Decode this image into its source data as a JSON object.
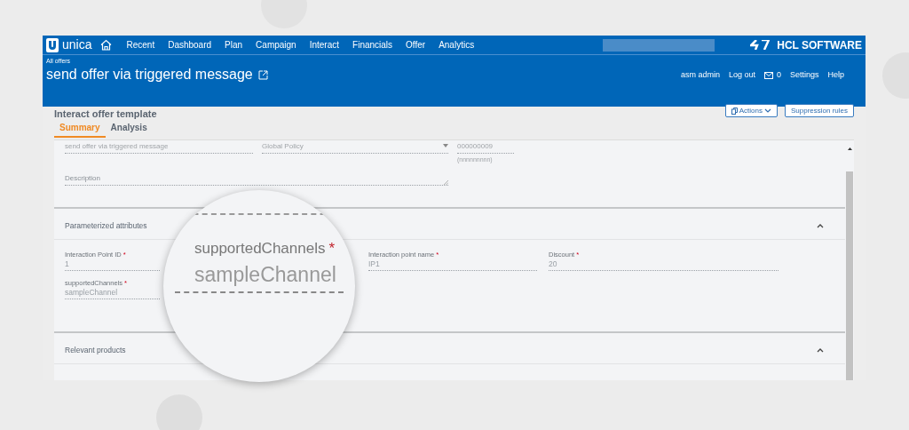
{
  "nav": {
    "logo": "unica",
    "items": [
      "Recent",
      "Dashboard",
      "Plan",
      "Campaign",
      "Interact",
      "Financials",
      "Offer",
      "Analytics"
    ],
    "brand": "HCL SOFTWARE"
  },
  "header": {
    "breadcrumb": "All offers",
    "title": "send offer via triggered message",
    "user": "asm admin",
    "logout": "Log out",
    "messages": "0",
    "links": [
      "Settings",
      "Help"
    ]
  },
  "page": {
    "subtitle": "Interact offer template",
    "actions": [
      "Actions",
      "Suppression rules"
    ],
    "tabs": [
      {
        "label": "Summary",
        "selected": true
      },
      {
        "label": "Analysis",
        "selected": false
      }
    ]
  },
  "form": {
    "name": "send offer via triggered message",
    "policy": "Global Policy",
    "code": "000000009",
    "code_hint": "(nnnnnnnnn)",
    "description_placeholder": "Description"
  },
  "sections": [
    {
      "title": "Parameterized attributes",
      "expanded": true,
      "fields": [
        {
          "label": "Interaction Point ID",
          "required_mark": "*",
          "value": "1"
        },
        {
          "label": "Interaction point name",
          "required_mark": "*",
          "value": "IP1"
        },
        {
          "label": "Discount",
          "required_mark": "*",
          "value": "20"
        },
        {
          "label": "supportedChannels",
          "required_mark": "*",
          "value": "sampleChannel"
        }
      ]
    },
    {
      "title": "Relevant products",
      "expanded": true
    }
  ],
  "magnifier": {
    "label": "supportedChannels",
    "required_mark": "*",
    "value": "sampleChannel"
  }
}
